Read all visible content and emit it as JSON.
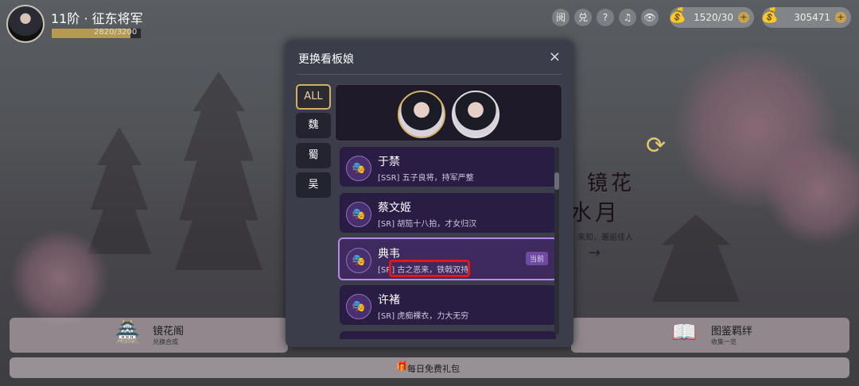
{
  "player": {
    "rank_title": "11阶 · 征东将军",
    "exp_text": "2820/3200",
    "exp_progress": 0.88
  },
  "top_icons": [
    "阅",
    "兑",
    "?",
    "♫",
    "👁"
  ],
  "currency": [
    {
      "icon": "money-bag-icon",
      "value": "1520/30"
    },
    {
      "icon": "coin-bag-icon",
      "value": "305471"
    }
  ],
  "dialog": {
    "title": "更换看板娘",
    "close": "×",
    "tabs": [
      "ALL",
      "魏",
      "蜀",
      "吴"
    ],
    "active_tab": "ALL",
    "characters": [
      {
        "name": "于禁",
        "desc": "[SSR] 五子良将，持军严整",
        "current": false
      },
      {
        "name": "蔡文姬",
        "desc": "[SR] 胡笳十八拍，才女归汉",
        "current": false
      },
      {
        "name": "典韦",
        "desc_prefix": "[SR]",
        "desc_highlight": "古之恶来，铁戟双持",
        "current": true,
        "badge": "当前"
      },
      {
        "name": "许褚",
        "desc": "[SR] 虎痴裸衣，力大无穷",
        "current": false
      }
    ]
  },
  "promo": {
    "title_line1": "镜花",
    "title_line2": "水月",
    "subtitle": "来知，邂逅佳人",
    "arrow": "→"
  },
  "bottom": {
    "left_button": {
      "label": "镜花阁",
      "sub": "兑换合成"
    },
    "right_button": {
      "label": "图鉴羁绊",
      "sub": "收集一览"
    },
    "gift_label": "每日免费礼包"
  },
  "colors": {
    "accent_gold": "#d1b065",
    "current_border": "#b58ae6",
    "highlight_red": "#e01818"
  }
}
